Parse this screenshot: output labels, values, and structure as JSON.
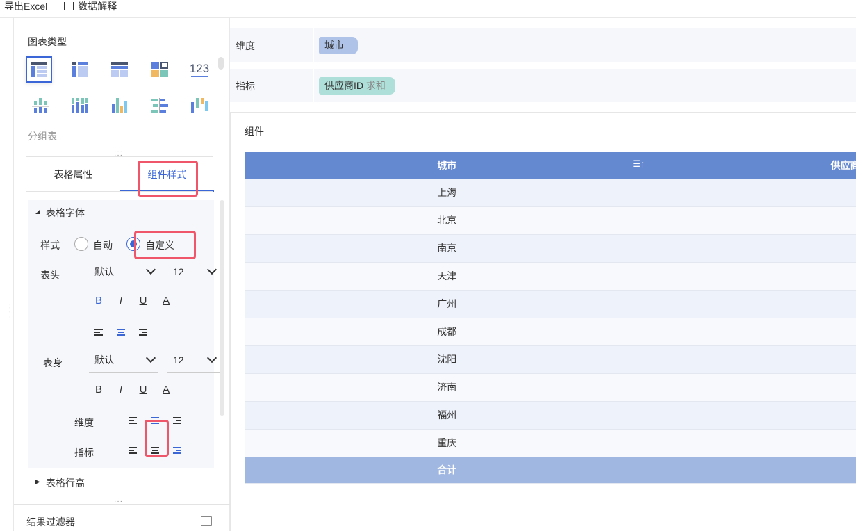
{
  "toolbar": {
    "export_label": "导出Excel",
    "explain_label": "数据解释"
  },
  "left": {
    "chart_type_title": "图表类型",
    "selected_chart": "分组表",
    "tabs": [
      {
        "label": "表格属性"
      },
      {
        "label": "组件样式",
        "active": true
      }
    ],
    "font_section": {
      "title": "表格字体",
      "style_label": "样式",
      "style_options": [
        {
          "label": "自动",
          "checked": false
        },
        {
          "label": "自定义",
          "checked": true
        }
      ],
      "header_label": "表头",
      "header_font": "默认",
      "header_size": "12",
      "body_label": "表身",
      "body_font": "默认",
      "body_size": "12",
      "dimension_label": "维度",
      "metric_label": "指标",
      "fmt": {
        "bold": "B",
        "italic": "I",
        "underline": "U",
        "color": "A"
      },
      "icon_123": "123"
    },
    "row_height_title": "表格行高",
    "filter_title": "结果过滤器"
  },
  "main": {
    "dimension_label": "维度",
    "dimension_pill": "城市",
    "metric_label": "指标",
    "metric_pill": "供应商ID",
    "metric_agg": "求和",
    "component_title": "组件",
    "table": {
      "headers": [
        "城市",
        "供应商"
      ],
      "rows": [
        "上海",
        "北京",
        "南京",
        "天津",
        "广州",
        "成都",
        "沈阳",
        "济南",
        "福州",
        "重庆"
      ],
      "total_label": "合计"
    }
  },
  "colors": {
    "accent": "#3a66d8",
    "header": "#6589d1",
    "highlight": "#f0566a"
  }
}
